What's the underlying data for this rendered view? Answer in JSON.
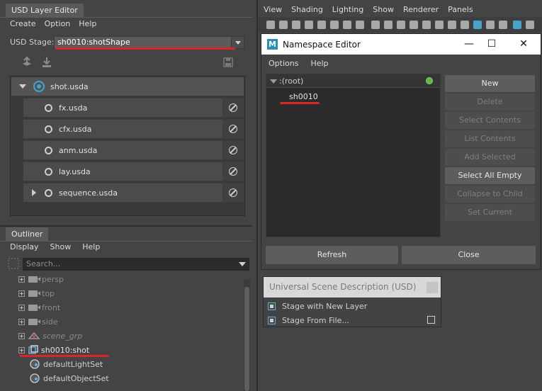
{
  "layer_editor": {
    "tab_title": "USD Layer Editor",
    "menu": [
      "Create",
      "Option",
      "Help"
    ],
    "stage_label": "USD Stage:",
    "stage_value": "sh0010:shotShape",
    "root_layer": "shot.usda",
    "sublayers": [
      "fx.usda",
      "cfx.usda",
      "anm.usda",
      "lay.usda",
      "sequence.usda"
    ]
  },
  "outliner": {
    "tab_title": "Outliner",
    "menu": [
      "Display",
      "Show",
      "Help"
    ],
    "search_placeholder": "Search...",
    "items": [
      "persp",
      "top",
      "front",
      "side",
      "scene_grp",
      "sh0010:shot",
      "defaultLightSet",
      "defaultObjectSet"
    ]
  },
  "viewport": {
    "menu": [
      "View",
      "Shading",
      "Lighting",
      "Show",
      "Renderer",
      "Panels"
    ]
  },
  "namespace_editor": {
    "title": "Namespace Editor",
    "menu": [
      "Options",
      "Help"
    ],
    "root": ":(root)",
    "child": "sh0010",
    "buttons": [
      "New",
      "Delete",
      "Select Contents",
      "List Contents",
      "Add Selected",
      "Select All Empty",
      "Collapse to Child",
      "Set Current"
    ],
    "refresh": "Refresh",
    "close": "Close"
  },
  "usd_menu": {
    "title": "Universal Scene Description (USD)",
    "items": [
      "Stage with New Layer",
      "Stage From File..."
    ]
  },
  "colors": {
    "annotation_red": "#d8262a",
    "accent_blue": "#5fb2d8",
    "status_green": "#69b14a"
  }
}
